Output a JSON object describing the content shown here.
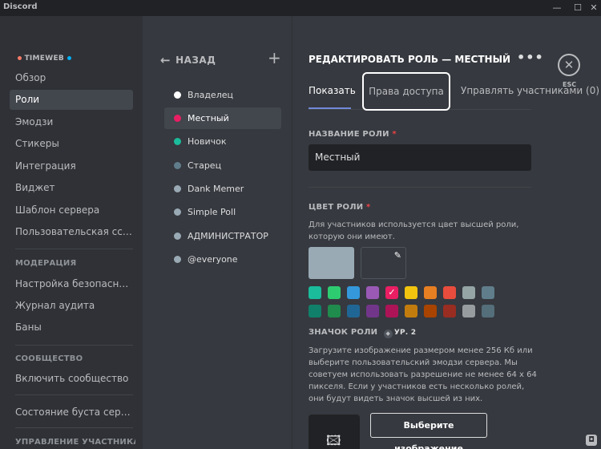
{
  "window": {
    "title": "Discord",
    "min": "—",
    "max": "☐",
    "close": "✕"
  },
  "server": {
    "name": "TIMEWEB",
    "dot_left_color": "#f47b67",
    "dot_right_color": "#00b0f4"
  },
  "sidebar": {
    "items": [
      {
        "label": "Обзор"
      },
      {
        "label": "Роли"
      },
      {
        "label": "Эмодзи"
      },
      {
        "label": "Стикеры"
      },
      {
        "label": "Интеграция"
      },
      {
        "label": "Виджет"
      },
      {
        "label": "Шаблон сервера"
      },
      {
        "label": "Пользовательская ссылка-приглашение"
      }
    ],
    "moderation_header": "МОДЕРАЦИЯ",
    "moderation_items": [
      {
        "label": "Настройка безопасности"
      },
      {
        "label": "Журнал аудита"
      },
      {
        "label": "Баны"
      }
    ],
    "community_header": "СООБЩЕСТВО",
    "community_items": [
      {
        "label": "Включить сообщество"
      }
    ],
    "boost_item": "Состояние буста сервера",
    "members_header": "УПРАВЛЕНИЕ УЧАСТНИКАМИ"
  },
  "roles": {
    "back_label": "НАЗАД",
    "add_icon": "+",
    "list": [
      {
        "name": "Владелец",
        "color": "#ffffff"
      },
      {
        "name": "Местный",
        "color": "#e91e63"
      },
      {
        "name": "Новичок",
        "color": "#1abc9c"
      },
      {
        "name": "Старец",
        "color": "#607d8b"
      },
      {
        "name": "Dank Memer",
        "color": "#99aab5"
      },
      {
        "name": "Simple Poll",
        "color": "#99aab5"
      },
      {
        "name": "АДМИНИСТРАТОР",
        "color": "#99aab5"
      },
      {
        "name": "@everyone",
        "color": "#99aab5"
      }
    ]
  },
  "editor": {
    "title": "РЕДАКТИРОВАТЬ РОЛЬ — МЕСТНЫЙ",
    "more": "•••",
    "close_icon": "✕",
    "esc": "ESC",
    "tabs": {
      "display": "Показать",
      "permissions": "Права доступа",
      "members": "Управлять участниками (0)"
    },
    "role_name_label": "НАЗВАНИЕ РОЛИ",
    "required_mark": "*",
    "role_name_value": "Местный",
    "role_color_label": "ЦВЕТ РОЛИ",
    "role_color_desc": "Для участников используется цвет высшей роли, которую они имеют.",
    "selected_color": "#99aab5",
    "palette_row1": [
      "#1abc9c",
      "#2ecc71",
      "#3498db",
      "#9b59b6",
      "#e91e63",
      "#f1c40f",
      "#e67e22",
      "#e74c3c",
      "#95a5a6",
      "#607d8b"
    ],
    "palette_row2": [
      "#11806a",
      "#1f8b4c",
      "#206694",
      "#71368a",
      "#ad1457",
      "#c27c0e",
      "#a84300",
      "#992d22",
      "#979c9f",
      "#546e7a"
    ],
    "selected_swatch_check": "✓",
    "role_icon_label": "ЗНАЧОК РОЛИ",
    "level_badge": "УР. 2",
    "role_icon_desc": "Загрузите изображение размером менее 256 Кб или выберите пользовательский эмодзи сервера. Мы советуем использовать разрешение не менее 64 x 64 пикселя. Если у участников есть несколько ролей, они будут видеть значок высшей из них.",
    "choose_image": "Выберите изображение"
  }
}
